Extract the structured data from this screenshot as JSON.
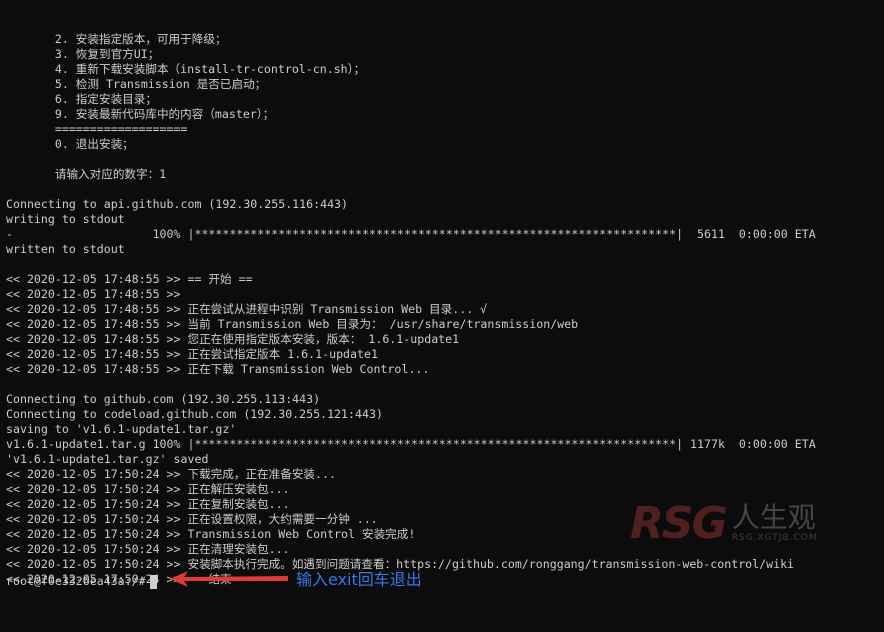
{
  "terminal": {
    "lines": [
      "       2. 安装指定版本，可用于降级；",
      "       3. 恢复到官方UI；",
      "       4. 重新下载安装脚本（install-tr-control-cn.sh）；",
      "       5. 检测 Transmission 是否已启动；",
      "       6. 指定安装目录；",
      "       9. 安装最新代码库中的内容（master）；",
      "       ===================",
      "       0. 退出安装；",
      "",
      "       请输入对应的数字：1",
      "",
      "Connecting to api.github.com (192.30.255.116:443)",
      "writing to stdout",
      "-                    100% |*********************************************************************|  5611  0:00:00 ETA",
      "written to stdout",
      "",
      "<< 2020-12-05 17:48:55 >> == 开始 ==",
      "<< 2020-12-05 17:48:55 >>",
      "<< 2020-12-05 17:48:55 >> 正在尝试从进程中识别 Transmission Web 目录... √",
      "<< 2020-12-05 17:48:55 >> 当前 Transmission Web 目录为： /usr/share/transmission/web",
      "<< 2020-12-05 17:48:55 >> 您正在使用指定版本安装，版本： 1.6.1-update1",
      "<< 2020-12-05 17:48:55 >> 正在尝试指定版本 1.6.1-update1",
      "<< 2020-12-05 17:48:55 >> 正在下载 Transmission Web Control...",
      "",
      "Connecting to github.com (192.30.255.113:443)",
      "Connecting to codeload.github.com (192.30.255.121:443)",
      "saving to 'v1.6.1-update1.tar.gz'",
      "v1.6.1-update1.tar.g 100% |*********************************************************************| 1177k  0:00:00 ETA",
      "'v1.6.1-update1.tar.gz' saved",
      "<< 2020-12-05 17:50:24 >> 下载完成，正在准备安装...",
      "<< 2020-12-05 17:50:24 >> 正在解压安装包...",
      "<< 2020-12-05 17:50:24 >> 正在复制安装包...",
      "<< 2020-12-05 17:50:24 >> 正在设置权限，大约需要一分钟 ...",
      "<< 2020-12-05 17:50:24 >> Transmission Web Control 安装完成!",
      "<< 2020-12-05 17:50:24 >> 正在清理安装包...",
      "<< 2020-12-05 17:50:24 >> 安装脚本执行完成。如遇到问题请查看：https://github.com/ronggang/transmission-web-control/wiki",
      "<< 2020-12-05 17:50:24 >> == 结束 =="
    ],
    "prompt": "root@f0e3326ea43a:/#"
  },
  "annotation": {
    "text": "输入exit回车退出",
    "color": "#2e7be6",
    "arrow_color": "#e03a3a"
  },
  "watermark": {
    "logo": "RSG",
    "cn": "人生观",
    "en": "RSG.XGTJB.COM"
  }
}
